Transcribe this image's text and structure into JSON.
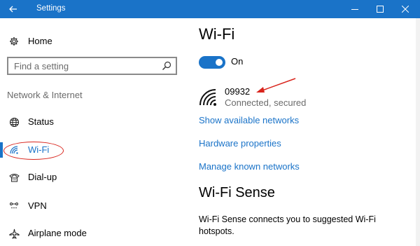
{
  "window": {
    "title": "Settings",
    "accent": "#1a73c8",
    "back_icon": "back-arrow-icon",
    "min_icon": "minimize-icon",
    "max_icon": "maximize-icon",
    "close_icon": "close-icon"
  },
  "sidebar": {
    "home_label": "Home",
    "search_placeholder": "Find a setting",
    "section_label": "Network & Internet",
    "items": [
      {
        "label": "Status",
        "icon": "globe-status-icon"
      },
      {
        "label": "Wi-Fi",
        "icon": "wifi-icon",
        "selected": true
      },
      {
        "label": "Dial-up",
        "icon": "dialup-phone-icon"
      },
      {
        "label": "VPN",
        "icon": "vpn-icon"
      },
      {
        "label": "Airplane mode",
        "icon": "airplane-icon"
      }
    ]
  },
  "main": {
    "title": "Wi-Fi",
    "toggle_label": "On",
    "toggle_on": true,
    "network": {
      "name": "09932",
      "status": "Connected, secured",
      "icon": "wifi-signal-icon"
    },
    "links": [
      "Show available networks",
      "Hardware properties",
      "Manage known networks"
    ],
    "sense_title": "Wi-Fi Sense",
    "sense_text": "Wi-Fi Sense connects you to suggested Wi-Fi hotspots."
  }
}
